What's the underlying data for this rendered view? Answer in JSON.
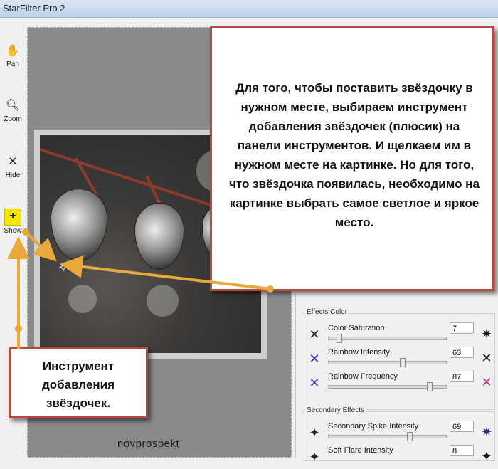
{
  "window": {
    "title": "StarFilter Pro 2"
  },
  "toolbar": {
    "tools": [
      {
        "label": "Pan",
        "icon": "hand-icon"
      },
      {
        "label": "Zoom",
        "icon": "magnifier-icon"
      },
      {
        "label": "Hide",
        "icon": "x-icon"
      },
      {
        "label": "Show",
        "icon": "plus-icon"
      }
    ]
  },
  "effects_color": {
    "title": "Effects Color",
    "rows": [
      {
        "label": "Color Saturation",
        "value": "7",
        "slider": 0.07
      },
      {
        "label": "Rainbow Intensity",
        "value": "63",
        "slider": 0.63
      },
      {
        "label": "Rainbow Frequency",
        "value": "87",
        "slider": 0.87
      }
    ]
  },
  "secondary_effects": {
    "title": "Secondary Effects",
    "rows": [
      {
        "label": "Secondary Spike Intensity",
        "value": "69",
        "slider": 0.69
      },
      {
        "label": "Soft Flare Intensity",
        "value": "8",
        "slider": 0.08
      }
    ]
  },
  "annotations": {
    "main_text": "Для того, чтобы поставить звёздочку в нужном месте, выбираем инструмент добавления звёздочек (плюсик) на панели инструментов. И щелкаем им в нужном месте на картинке. Но для того, что звёздочка появилась, необходимо на картинке выбрать самое светлое и яркое место.",
    "tool_text": "Инструмент добавления звёздочек."
  },
  "watermark": "novprospekt",
  "colors": {
    "callout_border": "#b74a3c",
    "arrow": "#e8a83a",
    "tool_highlight": "#f5e600"
  }
}
